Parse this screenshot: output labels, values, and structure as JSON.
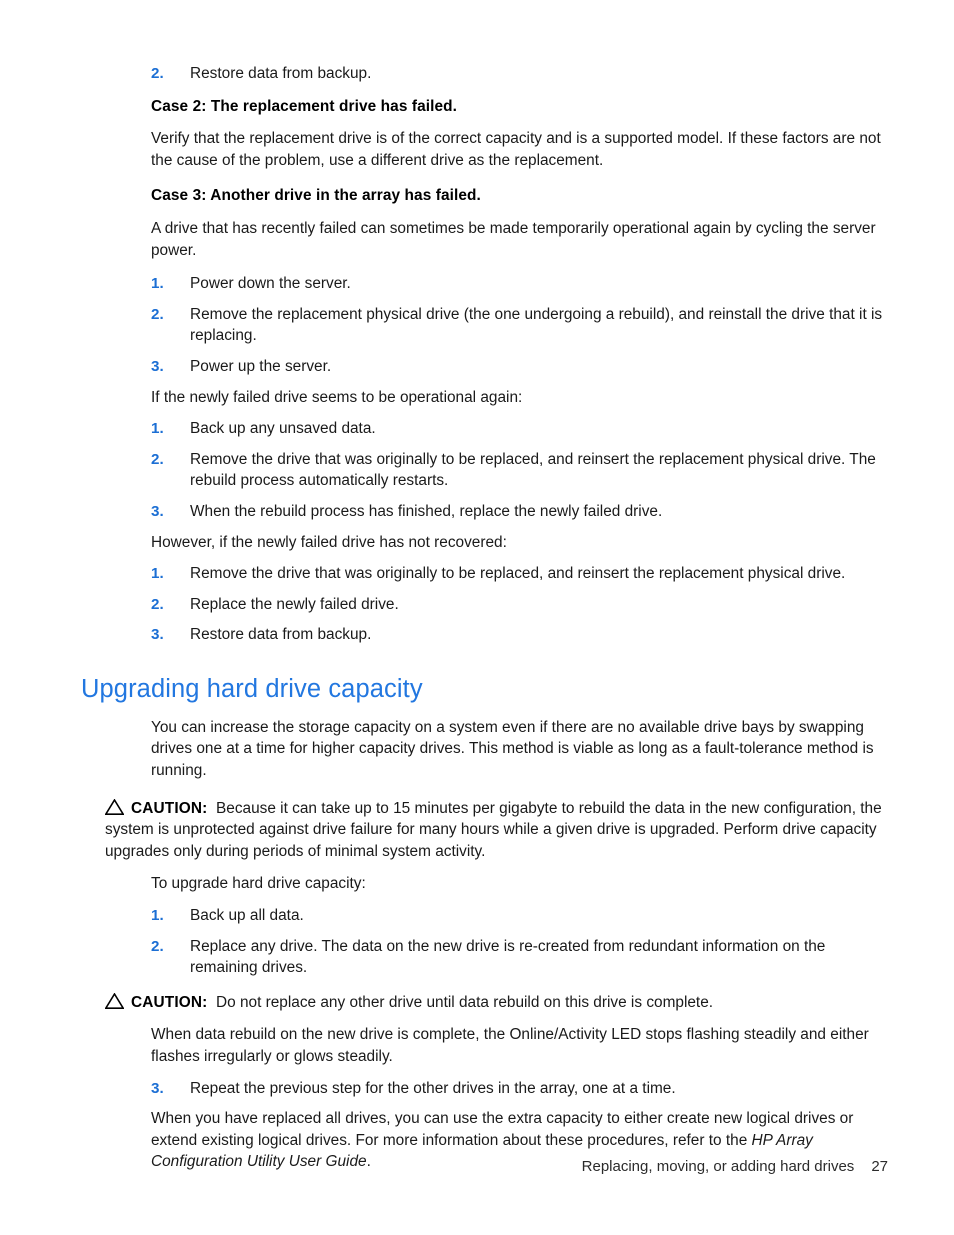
{
  "document": {
    "footer": {
      "chapter_title": "Replacing, moving, or adding hard drives",
      "page_number": "27"
    },
    "colors": {
      "heading_blue": "#2277e0",
      "list_number_blue": "#1c6fd4",
      "body_text": "#1a1a1a"
    }
  },
  "top_list": {
    "items": [
      {
        "num": "2.",
        "text": "Restore data from backup."
      }
    ]
  },
  "case2": {
    "heading": "Case 2: The replacement drive has failed.",
    "paragraph": "Verify that the replacement drive is of the correct capacity and is a supported model. If these factors are not the cause of the problem, use a different drive as the replacement."
  },
  "case3": {
    "heading": "Case 3: Another drive in the array has failed.",
    "paragraph": "A drive that has recently failed can sometimes be made temporarily operational again by cycling the server power.",
    "steps": [
      {
        "num": "1.",
        "text": "Power down the server."
      },
      {
        "num": "2.",
        "text": "Remove the replacement physical drive (the one undergoing a rebuild), and reinstall the drive that it is replacing."
      },
      {
        "num": "3.",
        "text": "Power up the server."
      }
    ],
    "operational_lead": "If the newly failed drive seems to be operational again:",
    "operational_steps": [
      {
        "num": "1.",
        "text": "Back up any unsaved data."
      },
      {
        "num": "2.",
        "text": "Remove the drive that was originally to be replaced, and reinsert the replacement physical drive. The rebuild process automatically restarts."
      },
      {
        "num": "3.",
        "text": "When the rebuild process has finished, replace the newly failed drive."
      }
    ],
    "not_recovered_lead": "However, if the newly failed drive has not recovered:",
    "not_recovered_steps": [
      {
        "num": "1.",
        "text": "Remove the drive that was originally to be replaced, and reinsert the replacement physical drive."
      },
      {
        "num": "2.",
        "text": "Replace the newly failed drive."
      },
      {
        "num": "3.",
        "text": "Restore data from backup."
      }
    ]
  },
  "upgrading": {
    "heading": "Upgrading hard drive capacity",
    "intro": "You can increase the storage capacity on a system even if there are no available drive bays by swapping drives one at a time for higher capacity drives. This method is viable as long as a fault-tolerance method is running.",
    "caution_1": {
      "icon": "warning-triangle-icon",
      "label": "CAUTION:",
      "text": "Because it can take up to 15 minutes per gigabyte to rebuild the data in the new configuration, the system is unprotected against drive failure for many hours while a given drive is upgraded. Perform drive capacity upgrades only during periods of minimal system activity."
    },
    "procedure_lead": "To upgrade hard drive capacity:",
    "steps_a": [
      {
        "num": "1.",
        "text": "Back up all data."
      },
      {
        "num": "2.",
        "text": "Replace any drive. The data on the new drive is re-created from redundant information on the remaining drives."
      }
    ],
    "caution_2": {
      "icon": "warning-triangle-icon",
      "label": "CAUTION:",
      "text": "Do not replace any other drive until data rebuild on this drive is complete."
    },
    "led_paragraph": "When data rebuild on the new drive is complete, the Online/Activity LED stops flashing steadily and either flashes irregularly or glows steadily.",
    "steps_b": [
      {
        "num": "3.",
        "text": "Repeat the previous step for the other drives in the array, one at a time."
      }
    ],
    "closing_part1": "When you have replaced all drives, you can use the extra capacity to either create new logical drives or extend existing logical drives. For more information about these procedures, refer to the ",
    "closing_italic": "HP Array Configuration Utility User Guide",
    "closing_part2": "."
  }
}
